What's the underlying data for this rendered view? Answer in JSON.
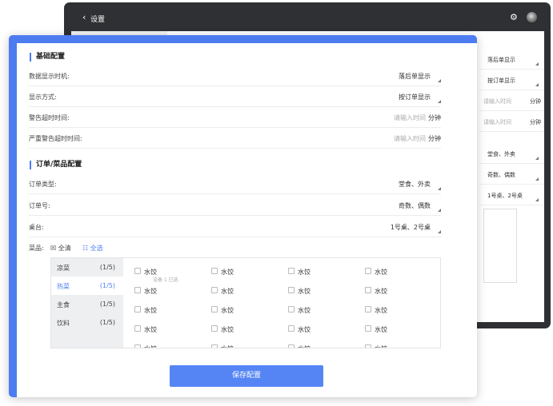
{
  "back_window": {
    "back_icon": "chevron-left-icon",
    "title": "设置",
    "settings_icon": "gear-icon",
    "avatar_icon": "avatar",
    "right_rows": [
      "落后单显示",
      "按订单显示",
      "堂食、外卖",
      "奇数、偶数",
      "1号桌、2号桌"
    ],
    "right_placeholder": "请输入时间",
    "right_unit": "分钟"
  },
  "basic": {
    "title": "基础配置",
    "rows": [
      {
        "label": "数据显示时机:",
        "value": "落后单显示"
      },
      {
        "label": "显示方式:",
        "value": "按订单显示"
      },
      {
        "label": "警告超时时间:",
        "placeholder": "请输入时间",
        "unit": "分钟"
      },
      {
        "label": "严重警告超时时间:",
        "placeholder": "请输入时间",
        "unit": "分钟"
      }
    ]
  },
  "order": {
    "title": "订单/菜品配置",
    "rows": [
      {
        "label": "订单类型:",
        "value": "堂食、外卖"
      },
      {
        "label": "订单号:",
        "value": "奇数、偶数"
      },
      {
        "label": "桌台:",
        "value": "1号桌、2号桌"
      }
    ]
  },
  "dishes": {
    "label": "菜品:",
    "clear_all": "☒ 全清",
    "select_all": "☷ 全选",
    "categories": [
      {
        "name": "凉菜",
        "count": "(1/5)"
      },
      {
        "name": "热菜",
        "count": "(1/5)"
      },
      {
        "name": "主食",
        "count": "(1/5)"
      },
      {
        "name": "饮料",
        "count": "(1/5)"
      }
    ],
    "item_name": "水饺",
    "subtext": "设备 1 已选"
  },
  "save_label": "保存配置",
  "colors": {
    "accent": "#4d7cf1",
    "button": "#5585f5",
    "device": "#2f3033"
  }
}
